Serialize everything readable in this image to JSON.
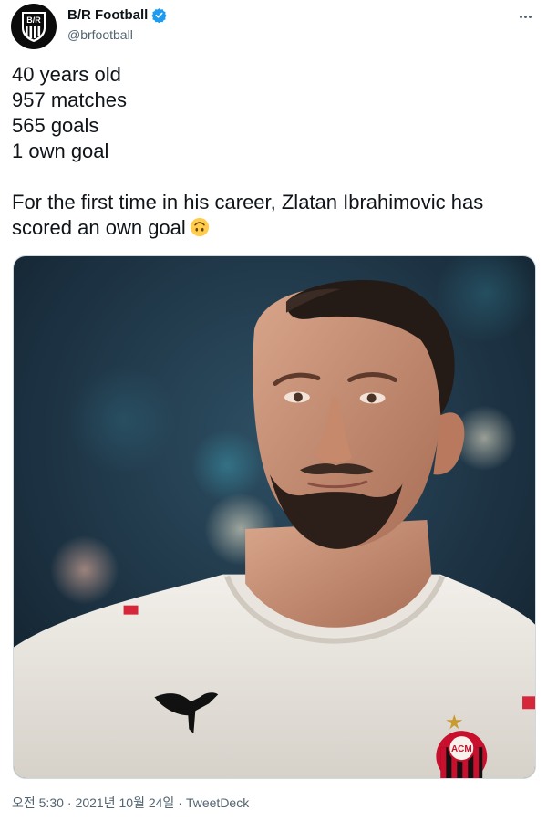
{
  "account": {
    "display_name": "B/R Football",
    "handle": "@brfootball",
    "avatar_letters": "B/R",
    "verified": true
  },
  "menu": {
    "more_icon": "more-horizontal-icon"
  },
  "tweet": {
    "lines": [
      "40 years old",
      "957 matches",
      "565 goals",
      "1 own goal"
    ],
    "paragraph": [
      "For the first time in his career, Zlatan Ibrahimovic has",
      "scored an own goal"
    ],
    "emoji": "upside-down-face"
  },
  "media": {
    "alt": "Zlatan Ibrahimovic in white AC Milan kit",
    "shirt_logo": "ACM"
  },
  "meta": {
    "time": "오전 5:30",
    "date": "2021년 10월 24일",
    "source": "TweetDeck",
    "separator": "·"
  },
  "colors": {
    "verified": "#1d9bf0",
    "text": "#0f1419",
    "muted": "#536471"
  }
}
